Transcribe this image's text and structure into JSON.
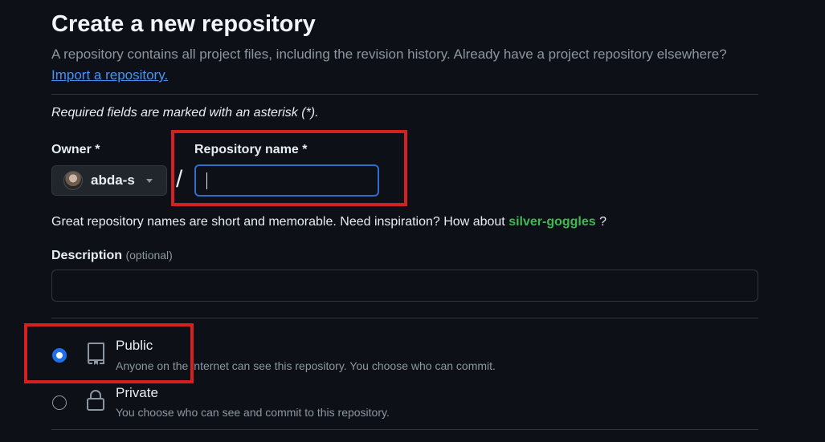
{
  "header": {
    "title": "Create a new repository",
    "subtitle": "A repository contains all project files, including the revision history. Already have a project repository elsewhere?",
    "import_link": "Import a repository."
  },
  "form": {
    "required_note": "Required fields are marked with an asterisk (*).",
    "owner": {
      "label": "Owner *",
      "value": "abda-s"
    },
    "separator": "/",
    "repo_name": {
      "label": "Repository name *",
      "value": ""
    },
    "name_hint": {
      "text": "Great repository names are short and memorable. Need inspiration? How about ",
      "suggestion": "silver-goggles",
      "suffix": " ?"
    },
    "description": {
      "label": "Description",
      "optional": "(optional)",
      "value": ""
    },
    "visibility": {
      "selected": "public",
      "options": [
        {
          "title": "Public",
          "description": "Anyone on the internet can see this repository. You choose who can commit.",
          "icon": "repo-icon"
        },
        {
          "title": "Private",
          "description": "You choose who can see and commit to this repository.",
          "icon": "lock-icon"
        }
      ]
    }
  },
  "colors": {
    "background": "#0d1117",
    "link": "#4493f8",
    "suggestion": "#3fb950",
    "focus_border": "#316dca",
    "highlight_box": "#d42020"
  }
}
